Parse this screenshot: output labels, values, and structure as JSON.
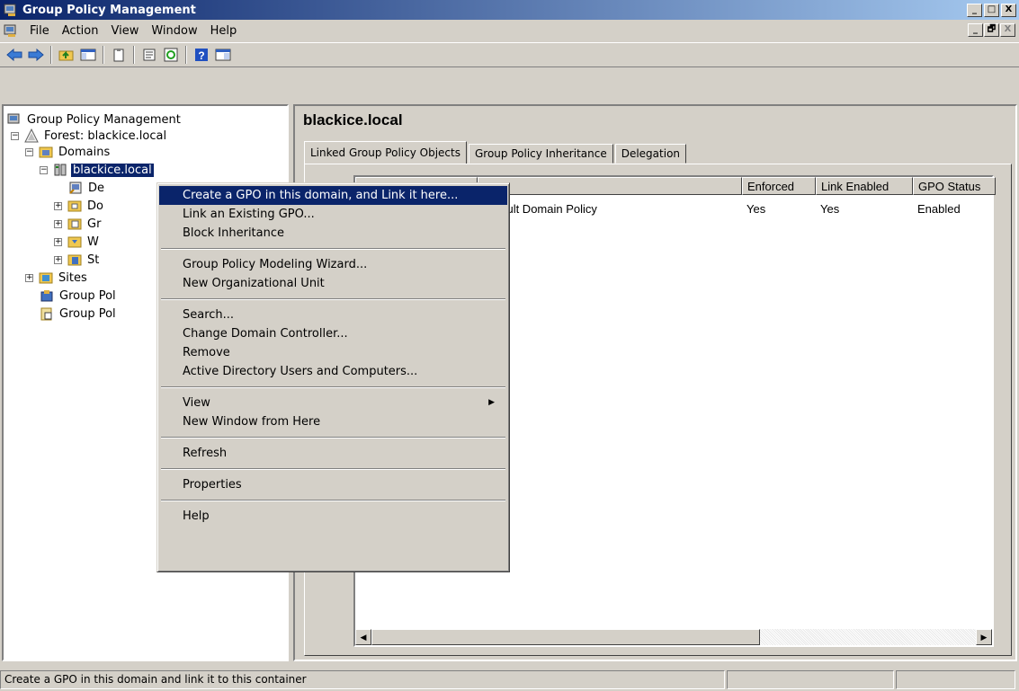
{
  "window": {
    "title": "Group Policy Management",
    "caption_buttons": [
      "_",
      "□",
      "X"
    ],
    "inner_buttons": [
      "_",
      "🗗",
      "X"
    ]
  },
  "menubar": [
    "File",
    "Action",
    "View",
    "Window",
    "Help"
  ],
  "toolbar": {
    "buttons": [
      "back-arrow-icon",
      "forward-arrow-icon",
      "up-folder-icon",
      "show-hide-tree-icon",
      "clipboard-icon",
      "export-list-icon",
      "refresh-icon",
      "help-icon",
      "console-tree-icon"
    ]
  },
  "tree": {
    "root": "Group Policy Management",
    "forest": "Forest: blackice.local",
    "domains": "Domains",
    "domain": "blackice.local",
    "child1": "De",
    "child2": "Do",
    "child3": "Gr",
    "child4": "W",
    "child5": "St",
    "sites": "Sites",
    "modeling": "Group Pol",
    "results": "Group Pol"
  },
  "right": {
    "title": "blackice.local",
    "tabs": [
      "Linked Group Policy Objects",
      "Group Policy Inheritance",
      "Delegation"
    ],
    "columns": [
      "",
      "",
      "Enforced",
      "Link Enabled",
      "GPO Status"
    ],
    "row": [
      "",
      "Default Domain Policy",
      "Yes",
      "Yes",
      "Enabled"
    ]
  },
  "context_menu": [
    {
      "label": "Create a GPO in this domain, and Link it here...",
      "highlighted": true
    },
    {
      "label": "Link an Existing GPO..."
    },
    {
      "label": "Block Inheritance"
    },
    {
      "sep": true
    },
    {
      "label": "Group Policy Modeling Wizard..."
    },
    {
      "label": "New Organizational Unit"
    },
    {
      "sep": true
    },
    {
      "label": "Search..."
    },
    {
      "label": "Change Domain Controller..."
    },
    {
      "label": "Remove"
    },
    {
      "label": "Active Directory Users and Computers..."
    },
    {
      "sep": true
    },
    {
      "label": "View",
      "submenu": true
    },
    {
      "label": "New Window from Here"
    },
    {
      "sep": true
    },
    {
      "label": "Refresh"
    },
    {
      "sep": true
    },
    {
      "label": "Properties"
    },
    {
      "sep": true
    },
    {
      "label": "Help"
    }
  ],
  "status": {
    "text": "Create a GPO in this domain and link it to this container"
  }
}
